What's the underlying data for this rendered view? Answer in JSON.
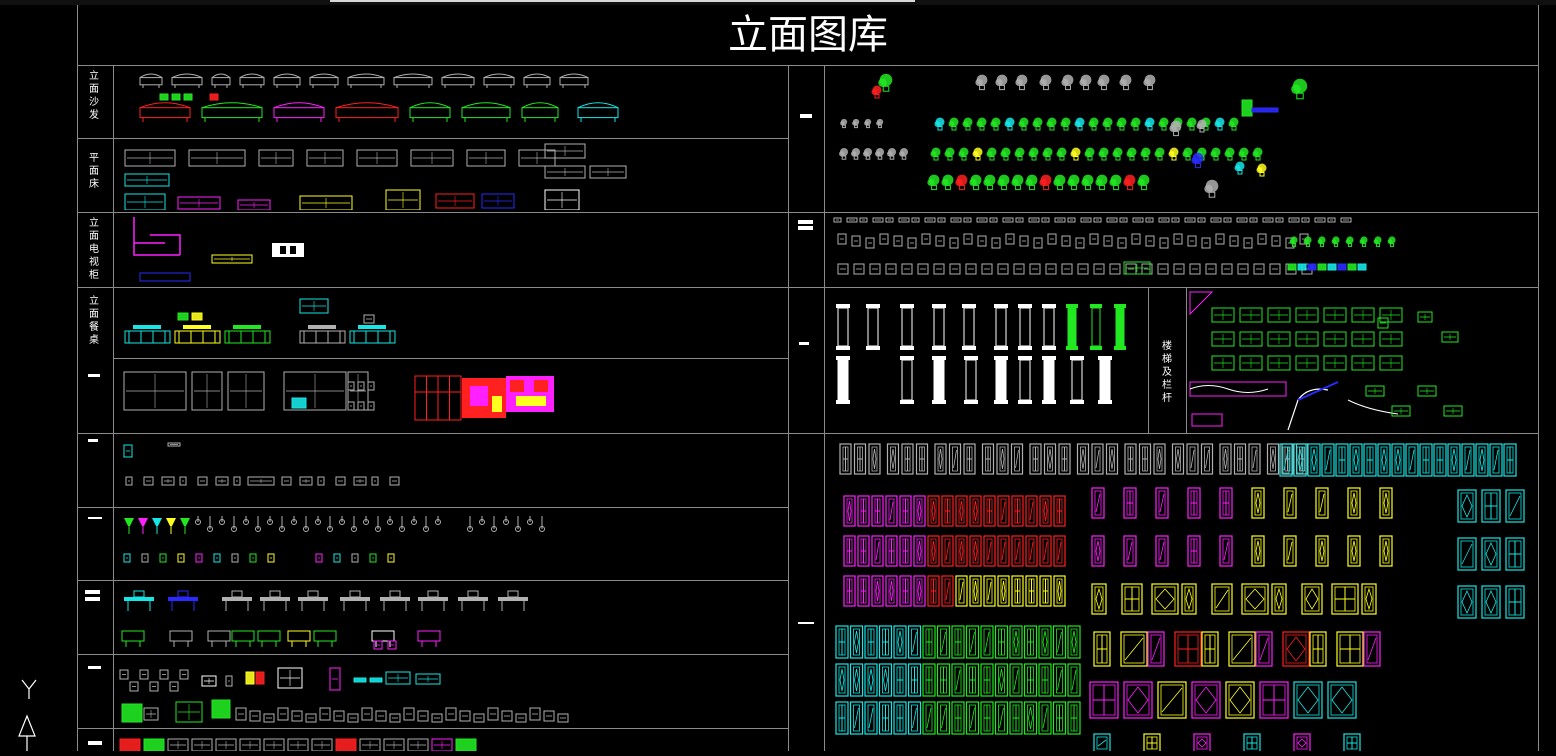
{
  "title": "立面图库",
  "left_sections": [
    {
      "label": "立面沙发"
    },
    {
      "label": "平面床"
    },
    {
      "label": "立面电视柜"
    },
    {
      "label": "立面餐桌"
    }
  ],
  "right_sections": [
    {
      "label": "楼梯及栏杆"
    }
  ],
  "colors": {
    "background": "#000000",
    "grid": "#8a8a8a",
    "red": "#ff2020",
    "green": "#22e822",
    "cyan": "#17e6e6",
    "magenta": "#ff20ff",
    "yellow": "#ffff20",
    "white": "#ffffff",
    "gray": "#b0b0b0",
    "blue": "#2a2aff"
  },
  "icons": [
    "ucs-y-axis-icon",
    "ucs-arrow-icon"
  ]
}
